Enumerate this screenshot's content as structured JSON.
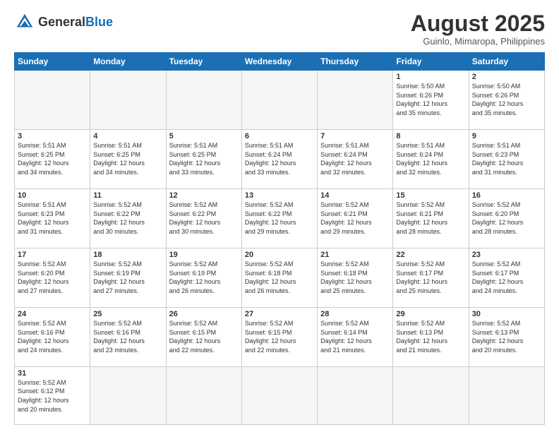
{
  "header": {
    "logo_general": "General",
    "logo_blue": "Blue",
    "month_year": "August 2025",
    "location": "Guinlo, Mimaropa, Philippines"
  },
  "weekdays": [
    "Sunday",
    "Monday",
    "Tuesday",
    "Wednesday",
    "Thursday",
    "Friday",
    "Saturday"
  ],
  "weeks": [
    [
      {
        "day": "",
        "info": ""
      },
      {
        "day": "",
        "info": ""
      },
      {
        "day": "",
        "info": ""
      },
      {
        "day": "",
        "info": ""
      },
      {
        "day": "",
        "info": ""
      },
      {
        "day": "1",
        "info": "Sunrise: 5:50 AM\nSunset: 6:26 PM\nDaylight: 12 hours\nand 35 minutes."
      },
      {
        "day": "2",
        "info": "Sunrise: 5:50 AM\nSunset: 6:26 PM\nDaylight: 12 hours\nand 35 minutes."
      }
    ],
    [
      {
        "day": "3",
        "info": "Sunrise: 5:51 AM\nSunset: 6:25 PM\nDaylight: 12 hours\nand 34 minutes."
      },
      {
        "day": "4",
        "info": "Sunrise: 5:51 AM\nSunset: 6:25 PM\nDaylight: 12 hours\nand 34 minutes."
      },
      {
        "day": "5",
        "info": "Sunrise: 5:51 AM\nSunset: 6:25 PM\nDaylight: 12 hours\nand 33 minutes."
      },
      {
        "day": "6",
        "info": "Sunrise: 5:51 AM\nSunset: 6:24 PM\nDaylight: 12 hours\nand 33 minutes."
      },
      {
        "day": "7",
        "info": "Sunrise: 5:51 AM\nSunset: 6:24 PM\nDaylight: 12 hours\nand 32 minutes."
      },
      {
        "day": "8",
        "info": "Sunrise: 5:51 AM\nSunset: 6:24 PM\nDaylight: 12 hours\nand 32 minutes."
      },
      {
        "day": "9",
        "info": "Sunrise: 5:51 AM\nSunset: 6:23 PM\nDaylight: 12 hours\nand 31 minutes."
      }
    ],
    [
      {
        "day": "10",
        "info": "Sunrise: 5:51 AM\nSunset: 6:23 PM\nDaylight: 12 hours\nand 31 minutes."
      },
      {
        "day": "11",
        "info": "Sunrise: 5:52 AM\nSunset: 6:22 PM\nDaylight: 12 hours\nand 30 minutes."
      },
      {
        "day": "12",
        "info": "Sunrise: 5:52 AM\nSunset: 6:22 PM\nDaylight: 12 hours\nand 30 minutes."
      },
      {
        "day": "13",
        "info": "Sunrise: 5:52 AM\nSunset: 6:22 PM\nDaylight: 12 hours\nand 29 minutes."
      },
      {
        "day": "14",
        "info": "Sunrise: 5:52 AM\nSunset: 6:21 PM\nDaylight: 12 hours\nand 29 minutes."
      },
      {
        "day": "15",
        "info": "Sunrise: 5:52 AM\nSunset: 6:21 PM\nDaylight: 12 hours\nand 28 minutes."
      },
      {
        "day": "16",
        "info": "Sunrise: 5:52 AM\nSunset: 6:20 PM\nDaylight: 12 hours\nand 28 minutes."
      }
    ],
    [
      {
        "day": "17",
        "info": "Sunrise: 5:52 AM\nSunset: 6:20 PM\nDaylight: 12 hours\nand 27 minutes."
      },
      {
        "day": "18",
        "info": "Sunrise: 5:52 AM\nSunset: 6:19 PM\nDaylight: 12 hours\nand 27 minutes."
      },
      {
        "day": "19",
        "info": "Sunrise: 5:52 AM\nSunset: 6:19 PM\nDaylight: 12 hours\nand 26 minutes."
      },
      {
        "day": "20",
        "info": "Sunrise: 5:52 AM\nSunset: 6:18 PM\nDaylight: 12 hours\nand 26 minutes."
      },
      {
        "day": "21",
        "info": "Sunrise: 5:52 AM\nSunset: 6:18 PM\nDaylight: 12 hours\nand 25 minutes."
      },
      {
        "day": "22",
        "info": "Sunrise: 5:52 AM\nSunset: 6:17 PM\nDaylight: 12 hours\nand 25 minutes."
      },
      {
        "day": "23",
        "info": "Sunrise: 5:52 AM\nSunset: 6:17 PM\nDaylight: 12 hours\nand 24 minutes."
      }
    ],
    [
      {
        "day": "24",
        "info": "Sunrise: 5:52 AM\nSunset: 6:16 PM\nDaylight: 12 hours\nand 24 minutes."
      },
      {
        "day": "25",
        "info": "Sunrise: 5:52 AM\nSunset: 6:16 PM\nDaylight: 12 hours\nand 23 minutes."
      },
      {
        "day": "26",
        "info": "Sunrise: 5:52 AM\nSunset: 6:15 PM\nDaylight: 12 hours\nand 22 minutes."
      },
      {
        "day": "27",
        "info": "Sunrise: 5:52 AM\nSunset: 6:15 PM\nDaylight: 12 hours\nand 22 minutes."
      },
      {
        "day": "28",
        "info": "Sunrise: 5:52 AM\nSunset: 6:14 PM\nDaylight: 12 hours\nand 21 minutes."
      },
      {
        "day": "29",
        "info": "Sunrise: 5:52 AM\nSunset: 6:13 PM\nDaylight: 12 hours\nand 21 minutes."
      },
      {
        "day": "30",
        "info": "Sunrise: 5:52 AM\nSunset: 6:13 PM\nDaylight: 12 hours\nand 20 minutes."
      }
    ],
    [
      {
        "day": "31",
        "info": "Sunrise: 5:52 AM\nSunset: 6:12 PM\nDaylight: 12 hours\nand 20 minutes."
      },
      {
        "day": "",
        "info": ""
      },
      {
        "day": "",
        "info": ""
      },
      {
        "day": "",
        "info": ""
      },
      {
        "day": "",
        "info": ""
      },
      {
        "day": "",
        "info": ""
      },
      {
        "day": "",
        "info": ""
      }
    ]
  ]
}
